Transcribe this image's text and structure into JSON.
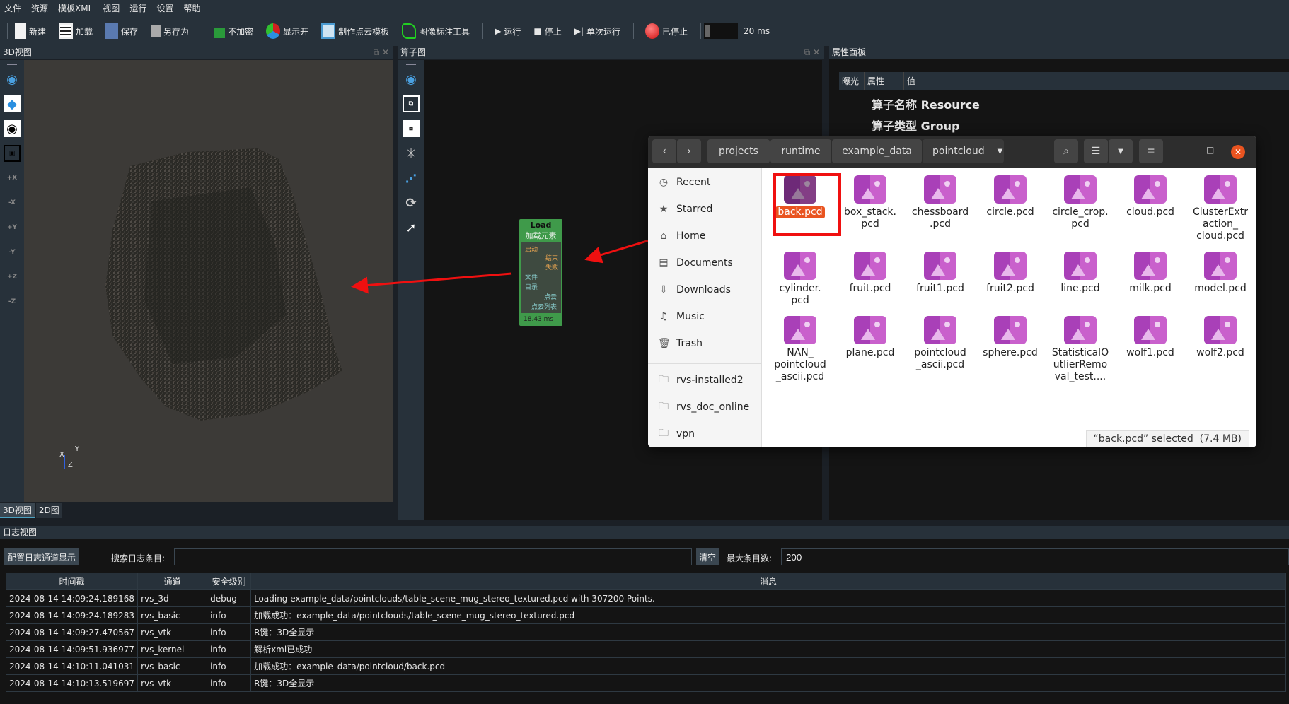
{
  "menu": [
    "文件",
    "资源",
    "模板XML",
    "视图",
    "运行",
    "设置",
    "帮助"
  ],
  "toolbar": {
    "new": "新建",
    "load": "加载",
    "save": "保存",
    "save_as": "另存为",
    "no_encrypt": "不加密",
    "show_open": "显示开",
    "make_template": "制作点云模板",
    "annotate": "图像标注工具",
    "run": "运行",
    "stop": "停止",
    "single_run": "单次运行",
    "status": "已停止",
    "interval": "20 ms",
    "status_color": "#e02020"
  },
  "view3d": {
    "title": "3D视图",
    "tabs": [
      "3D视图",
      "2D图"
    ],
    "side_icons": [
      "eye-icon",
      "cube-icon",
      "target-icon",
      "screenshot-icon",
      "+X",
      "-X",
      "+Y",
      "-Y",
      "+Z",
      "-Z"
    ],
    "axes": {
      "x": "X",
      "y": "Y",
      "z": "Z"
    }
  },
  "operator": {
    "title": "算子图",
    "node": {
      "title": "Load",
      "subtitle": "加载元素",
      "in_ports": [
        "启动",
        "文件",
        "目录"
      ],
      "out_ports": [
        "结束",
        "失败",
        "点云",
        "点云列表"
      ],
      "time": "18.43 ms",
      "color": "#3f9a4a"
    }
  },
  "props": {
    "title": "属性面板",
    "columns": [
      "曝光",
      "属性",
      "值"
    ],
    "rows": [
      {
        "key": "算子名称",
        "value": "Resource"
      },
      {
        "key": "算子类型",
        "value": "Group"
      }
    ]
  },
  "dialog": {
    "path": [
      "projects",
      "runtime",
      "example_data",
      "pointcloud"
    ],
    "sidebar": [
      "Recent",
      "Starred",
      "Home",
      "Documents",
      "Downloads",
      "Music",
      "Trash"
    ],
    "bookmarks": [
      "rvs-installed2",
      "rvs_doc_online",
      "vpn"
    ],
    "files": [
      "back.pcd",
      "box_stack.\npcd",
      "chessboard\n.pcd",
      "circle.pcd",
      "circle_crop.\npcd",
      "cloud.pcd",
      "ClusterExtr\naction_\ncloud.pcd",
      "cylinder.\npcd",
      "fruit.pcd",
      "fruit1.pcd",
      "fruit2.pcd",
      "line.pcd",
      "milk.pcd",
      "model.pcd",
      "NAN_\npointcloud\n_ascii.pcd",
      "plane.pcd",
      "pointcloud\n_ascii.pcd",
      "sphere.pcd",
      "StatisticalO\nutlierRemo\nval_test....",
      "wolf1.pcd",
      "wolf2.pcd"
    ],
    "selected": "back.pcd",
    "status": "“back.pcd” selected  (7.4 MB)",
    "selection_color": "#e95420"
  },
  "log": {
    "title": "日志视图",
    "config_button": "配置日志通道显示",
    "search_label": "搜索日志条目:",
    "search_value": "",
    "clear": "清空",
    "max_label": "最大条目数:",
    "max_value": "200",
    "columns": [
      "时间戳",
      "通道",
      "安全级别",
      "消息"
    ],
    "rows": [
      [
        "2024-08-14 14:09:24.189168",
        "rvs_3d",
        "debug",
        " Loading example_data/pointclouds/table_scene_mug_stereo_textured.pcd with 307200 Points."
      ],
      [
        "2024-08-14 14:09:24.189283",
        "rvs_basic",
        "info",
        "加载成功：example_data/pointclouds/table_scene_mug_stereo_textured.pcd"
      ],
      [
        "2024-08-14 14:09:27.470567",
        "rvs_vtk",
        "info",
        "R键：3D全显示"
      ],
      [
        "2024-08-14 14:09:51.936977",
        "rvs_kernel",
        "info",
        "解析xml已成功"
      ],
      [
        "2024-08-14 14:10:11.041031",
        "rvs_basic",
        "info",
        "加载成功：example_data/pointcloud/back.pcd"
      ],
      [
        "2024-08-14 14:10:13.519697",
        "rvs_vtk",
        "info",
        "R键：3D全显示"
      ]
    ]
  }
}
